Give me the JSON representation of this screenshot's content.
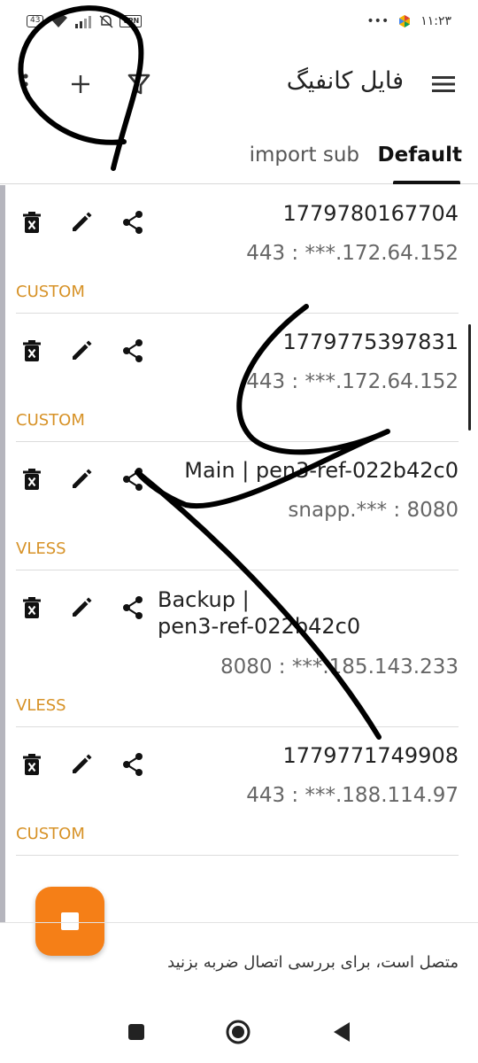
{
  "status_bar": {
    "time": "۱۱:۲۳",
    "dots": "•••",
    "battery": "43",
    "vpn": "VPN"
  },
  "app_bar": {
    "title": "فایل کانفیگ",
    "icons": [
      "menu-icon",
      "plus-icon",
      "filter-icon",
      "more-vert-icon"
    ]
  },
  "tabs": [
    {
      "label": "Default",
      "selected": true
    },
    {
      "label": "import sub",
      "selected": false
    }
  ],
  "configs": [
    {
      "name": "1779780167704",
      "address": "443 : ***.172.64.152",
      "type": "CUSTOM"
    },
    {
      "name": "1779775397831",
      "address": "443 : ***.172.64.152",
      "type": "CUSTOM"
    },
    {
      "name": "Main | pen3-ref-022b42c0",
      "address": "snapp.*** : 8080",
      "type": "VLESS"
    },
    {
      "name": "Backup | pen3-ref-022b42c0",
      "name_line1": "Backup |",
      "name_line2": "pen3-ref-022b42c0",
      "address": "8080 : ***.185.143.233",
      "type": "VLESS"
    },
    {
      "name": "1779771749908",
      "address": "443 : ***.188.114.97",
      "type": "CUSTOM"
    }
  ],
  "fab": {
    "icon": "stop-icon"
  },
  "connection_status": "متصل است، برای بررسی اتصال ضربه بزنید",
  "colors": {
    "accent": "#f57f17",
    "type_label": "#d79227",
    "tab_indicator": "#111111"
  }
}
